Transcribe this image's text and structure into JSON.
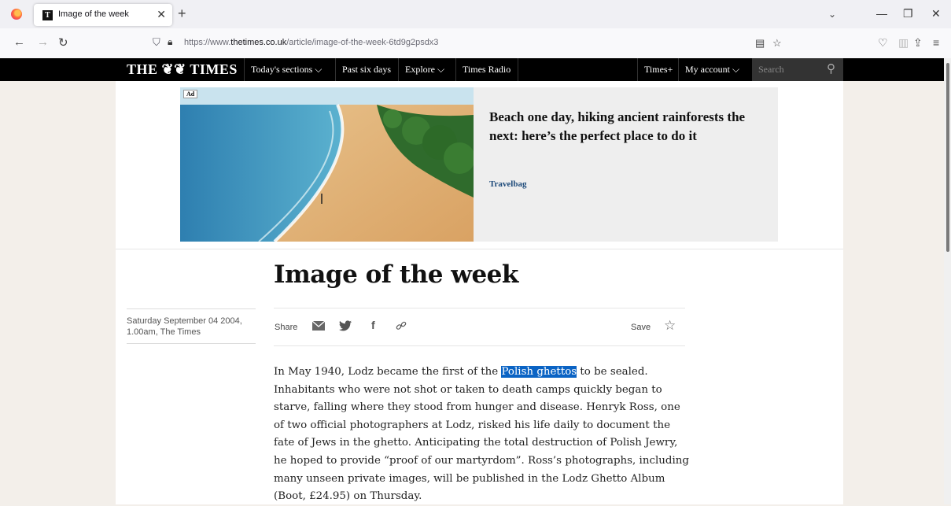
{
  "browser": {
    "tab_title": "Image of the week",
    "tab_favicon": "T",
    "url_prefix": "https://www.",
    "url_domain": "thetimes.co.uk",
    "url_path": "/article/image-of-the-week-6td9g2psdx3"
  },
  "times_nav": {
    "masthead": "THE ❦❦ TIMES",
    "items": [
      "Today's sections ⌵",
      "Past six days",
      "Explore ⌵",
      "Times Radio"
    ],
    "right_items": [
      "Times+",
      "My account ⌵"
    ],
    "search_placeholder": "Search"
  },
  "ad": {
    "label": "Ad",
    "title": "Beach one day, hiking ancient rainforests the next: here’s the perfect place to do it",
    "sponsor": "Travelbag"
  },
  "article": {
    "headline": "Image of the week",
    "dateline_1": "Saturday September 04 2004,",
    "dateline_2": "1.00am, The Times",
    "share_label": "Share",
    "save_label": "Save",
    "body_before": "In May 1940, Lodz became the first of the ",
    "body_highlight": "Polish ghettos",
    "body_after": " to be sealed. Inhabitants who were not shot or taken to death camps quickly began to starve, falling where they stood from hunger and disease. Henryk Ross, one of two official photographers at Lodz, risked his life daily to document the fate of Jews in the ghetto. Anticipating the total destruction of Polish Jewry, he hoped to provide “proof of our martyrdom”. Ross’s photographs, including many unseen private images, will be published in the Lodz Ghetto Album (Boot, £24.95) on Thursday."
  },
  "colors": {
    "nav_bg": "#000000",
    "highlight": "#0a63c4",
    "sponsor": "#1d4a7a",
    "page_bg": "#f3efea"
  }
}
